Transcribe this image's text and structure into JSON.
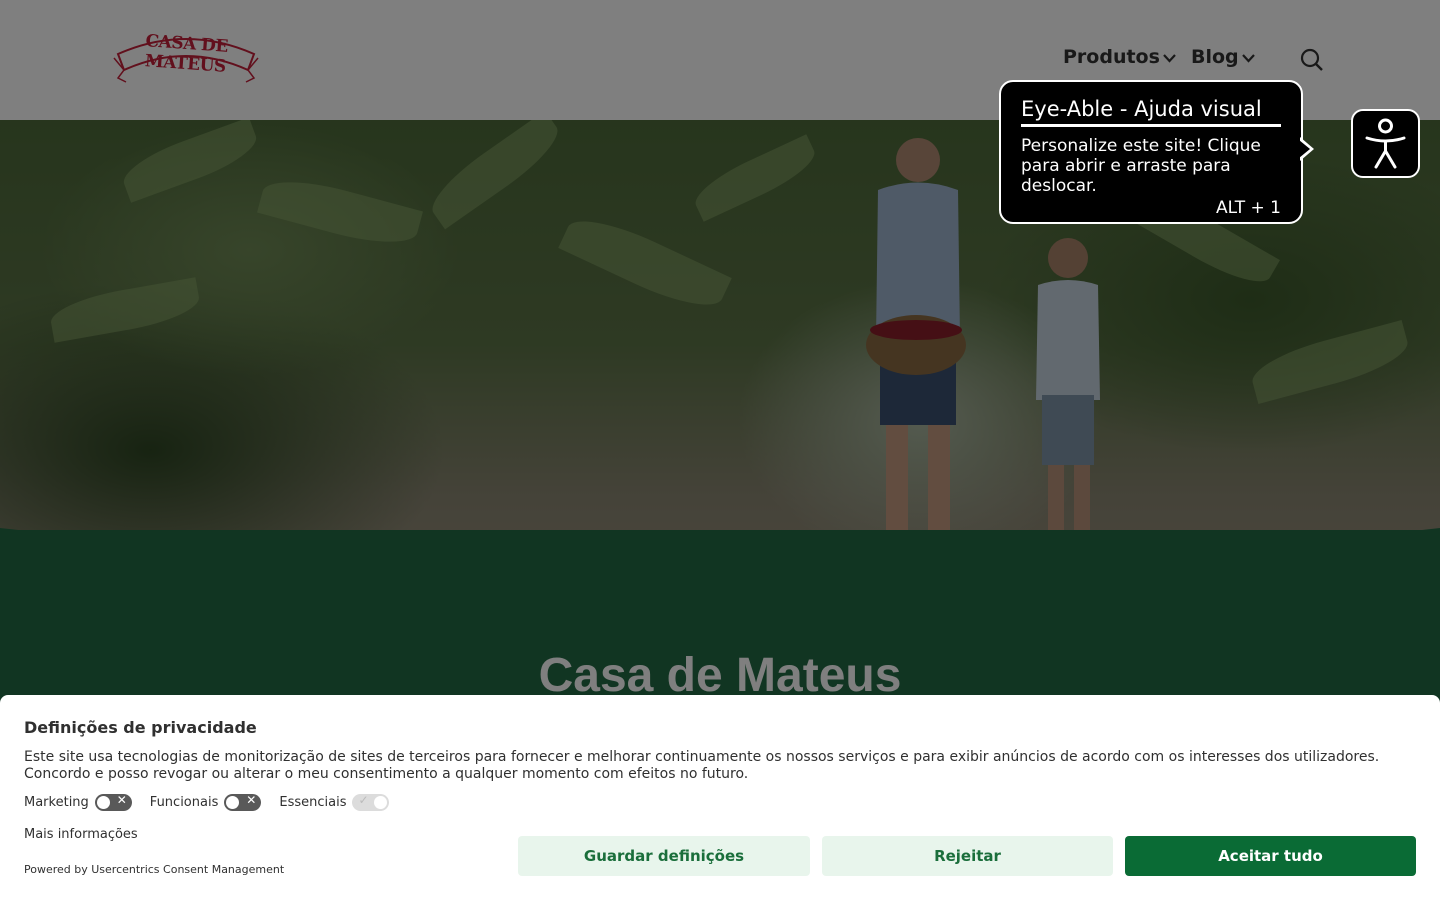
{
  "header": {
    "logo_text": "CASA DE MATEUS",
    "nav": [
      {
        "label": "Produtos"
      },
      {
        "label": "Blog"
      }
    ]
  },
  "main": {
    "section_title": "Casa de Mateus"
  },
  "eyeable": {
    "title": "Eye-Able - Ajuda visual",
    "body": "Personalize este site! Clique para abrir e arraste para deslocar.",
    "shortcut": "ALT + 1"
  },
  "consent": {
    "title": "Definições de privacidade",
    "text": "Este site usa tecnologias de monitorização de sites de terceiros para fornecer e melhorar continuamente os nossos serviços e para exibir anúncios de acordo com os interesses dos utilizadores. Concordo e posso revogar ou alterar o meu consentimento a qualquer momento com efeitos no futuro.",
    "toggles": [
      {
        "label": "Marketing",
        "on": false
      },
      {
        "label": "Funcionais",
        "on": false
      },
      {
        "label": "Essenciais",
        "on": true
      }
    ],
    "more_info": "Mais informações",
    "powered_by": "Powered by Usercentrics Consent Management",
    "buttons": {
      "save": "Guardar definições",
      "reject": "Rejeitar",
      "accept": "Aceitar tudo"
    }
  },
  "colors": {
    "brand_red": "#c4203b",
    "section_green": "#236b45",
    "accept_green": "#0a6b35",
    "light_button": "#e8f5ec"
  }
}
